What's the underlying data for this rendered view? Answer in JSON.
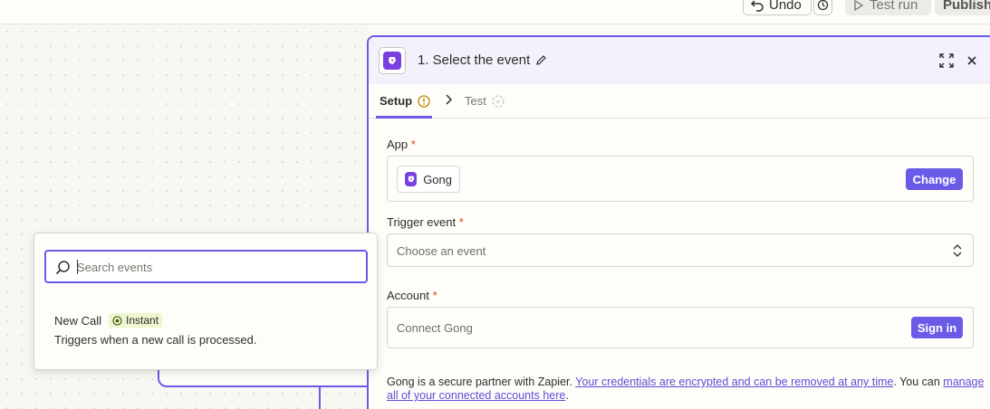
{
  "topbar": {
    "undo_label": "Undo",
    "test_run_label": "Test run",
    "publish_label": "Publish"
  },
  "panel": {
    "title": "1. Select the event",
    "tabs": [
      {
        "label": "Setup"
      },
      {
        "label": "Test"
      }
    ],
    "app": {
      "label": "App",
      "required_mark": "*",
      "selected_app": "Gong",
      "change_label": "Change"
    },
    "trigger": {
      "label": "Trigger event",
      "required_mark": "*",
      "placeholder": "Choose an event"
    },
    "account": {
      "label": "Account",
      "required_mark": "*",
      "placeholder": "Connect Gong",
      "sign_in_label": "Sign in"
    },
    "footer": {
      "text_1": "Gong is a secure partner with Zapier. ",
      "link_1": "Your credentials are encrypted and can be removed at any time",
      "text_2": ". You can ",
      "link_2": "manage all of your connected accounts here",
      "text_3": "."
    }
  },
  "popup": {
    "search_placeholder": "Search events",
    "items": [
      {
        "title": "New Call",
        "badge": "Instant",
        "description": "Triggers when a new call is processed."
      }
    ]
  },
  "colors": {
    "accent": "#695be8",
    "gong_brand": "#7a3fe0",
    "required": "#d9481b",
    "instant_badge_bg": "#eef6cf"
  }
}
